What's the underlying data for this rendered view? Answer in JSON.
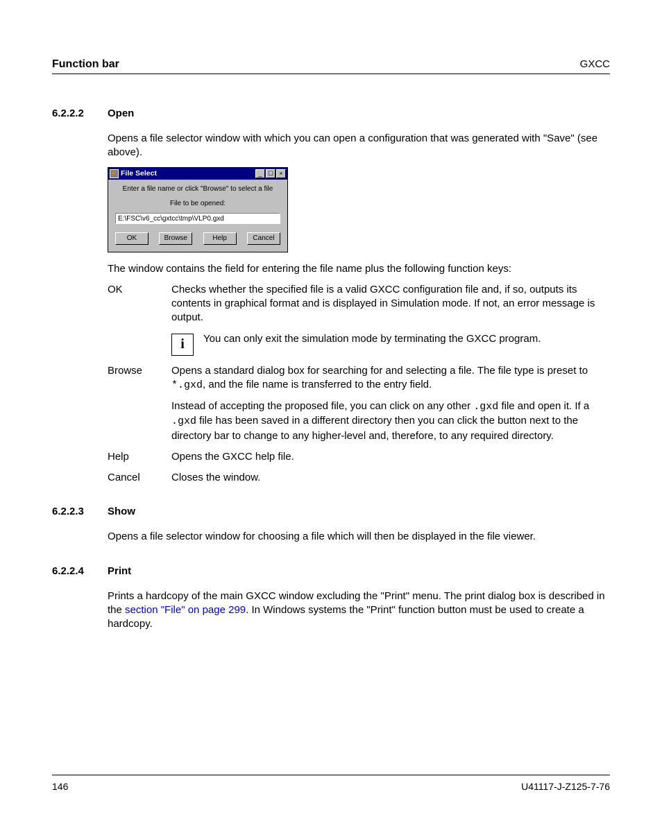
{
  "header": {
    "left": "Function bar",
    "right": "GXCC"
  },
  "sec_open": {
    "num": "6.2.2.2",
    "title": "Open",
    "intro": "Opens a file selector window with which you can open a configuration that was generated with \"Save\" (see above).",
    "after_fig": "The window contains the field for entering the file name plus the following function keys:"
  },
  "file_select": {
    "title": "File Select",
    "instruct": "Enter a file name or click \"Browse\" to select a file",
    "label": "File to be opened:",
    "value": "E:\\FSC\\v6_cc\\gxtcc\\tmp\\VLP0.gxd",
    "buttons": {
      "ok": "OK",
      "browse": "Browse",
      "help": "Help",
      "cancel": "Cancel"
    },
    "winbtn": {
      "min": "_",
      "max": "☐",
      "close": "×"
    }
  },
  "defs": {
    "ok": {
      "term": "OK",
      "body": "Checks whether the specified file is a valid GXCC configuration file and, if so, outputs its contents in graphical format and is displayed in Simulation mode. If not, an error message is output."
    },
    "info": {
      "icon": "i",
      "text": "You can only exit the simulation mode by terminating the GXCC program."
    },
    "browse": {
      "term": "Browse",
      "p1a": "Opens a standard dialog box for searching for and selecting a file. The file type is preset to ",
      "p1code": "*.gxd",
      "p1b": ", and the file name is transferred to the entry field.",
      "p2a": "Instead of accepting the proposed file, you can click on any other ",
      "p2code1": ".gxd",
      "p2b": " file and open it. If a ",
      "p2code2": ".gxd",
      "p2c": " file has been saved in a different directory then you can click the button next to the directory bar to change to any higher-level and, therefore, to any required directory."
    },
    "help": {
      "term": "Help",
      "body": "Opens the GXCC help file."
    },
    "cancel": {
      "term": "Cancel",
      "body": "Closes the window."
    }
  },
  "sec_show": {
    "num": "6.2.2.3",
    "title": "Show",
    "body": "Opens a file selector window for choosing a file which will then be displayed in the file viewer."
  },
  "sec_print": {
    "num": "6.2.2.4",
    "title": "Print",
    "p1a": "Prints a hardcopy of the main GXCC window excluding the \"Print\" menu. The print dialog box is described in the ",
    "link": "section \"File\" on page 299",
    "p1b": ". In Windows systems the \"Print\" function button must be used to create a hardcopy."
  },
  "footer": {
    "page": "146",
    "docid": "U41117-J-Z125-7-76"
  }
}
